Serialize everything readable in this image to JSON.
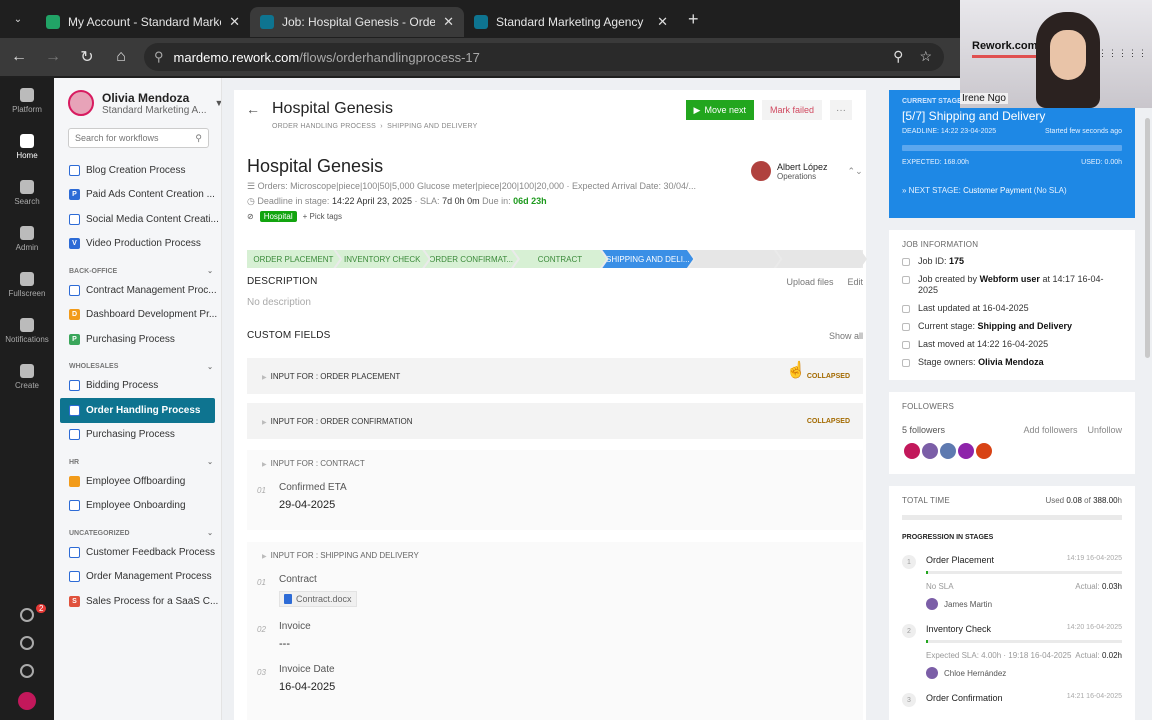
{
  "browser": {
    "tabs": [
      {
        "label": "My Account - Standard Marketi",
        "color": "#21a366",
        "active": false
      },
      {
        "label": "Job: Hospital Genesis - Order H",
        "color": "#0e7490",
        "active": true
      },
      {
        "label": "Standard Marketing Agency",
        "color": "#0e7490",
        "active": false
      }
    ],
    "url_host": "mardemo.rework.com",
    "url_path": "/flows/orderhandlingprocess-17"
  },
  "rail": {
    "items": [
      "Platform",
      "Home",
      "Search",
      "Admin",
      "Fullscreen",
      "Notifications",
      "Create"
    ],
    "badge": "2"
  },
  "sidebar": {
    "user_name": "Olivia Mendoza",
    "user_org": "Standard Marketing A...",
    "search_placeholder": "Search for workflows",
    "top_items": [
      {
        "label": "Blog Creation Process",
        "icon": "outline"
      },
      {
        "label": "Paid Ads Content Creation ...",
        "icon": "blue",
        "letter": "P"
      },
      {
        "label": "Social Media Content Creati...",
        "icon": "outline"
      },
      {
        "label": "Video Production Process",
        "icon": "blue",
        "letter": "V"
      }
    ],
    "groups": [
      {
        "name": "BACK-OFFICE",
        "items": [
          {
            "label": "Contract Management Proc...",
            "icon": "outline"
          },
          {
            "label": "Dashboard Development Pr...",
            "icon": "orange",
            "letter": "D"
          },
          {
            "label": "Purchasing Process",
            "icon": "green",
            "letter": "P"
          }
        ]
      },
      {
        "name": "WHOLESALES",
        "items": [
          {
            "label": "Bidding Process",
            "icon": "outline"
          },
          {
            "label": "Order Handling Process",
            "icon": "outline",
            "active": true
          },
          {
            "label": "Purchasing Process",
            "icon": "outline"
          }
        ]
      },
      {
        "name": "HR",
        "items": [
          {
            "label": "Employee Offboarding",
            "icon": "orange"
          },
          {
            "label": "Employee Onboarding",
            "icon": "outline"
          }
        ]
      },
      {
        "name": "UNCATEGORIZED",
        "items": [
          {
            "label": "Customer Feedback Process",
            "icon": "outline"
          },
          {
            "label": "Order Management Process",
            "icon": "outline"
          },
          {
            "label": "Sales Process for a SaaS C...",
            "icon": "red",
            "letter": "S"
          }
        ]
      }
    ]
  },
  "header": {
    "title": "Hospital Genesis",
    "crumb_1": "ORDER HANDLING PROCESS",
    "crumb_2": "SHIPPING AND DELIVERY",
    "move_next": "Move next",
    "mark_failed": "Mark failed",
    "more": "···"
  },
  "job": {
    "title": "Hospital Genesis",
    "meta": "Orders: Microscope|piece|100|50|5,000 Glucose meter|piece|200|100|20,000 · Expected Arrival Date: 30/04/...",
    "deadline_label": "Deadline in stage:",
    "deadline_value": "14:22 April 23, 2025",
    "sla_label": "· SLA:",
    "sla_value": "7d 0h 0m",
    "due_label": "Due in:",
    "due_value": "06d 23h",
    "tag": "Hospital",
    "pick_tags": "+ Pick tags",
    "assignee_name": "Albert López",
    "assignee_role": "Operations"
  },
  "stages": [
    {
      "label": "ORDER PLACEMENT",
      "state": "done"
    },
    {
      "label": "INVENTORY CHECK",
      "state": "done"
    },
    {
      "label": "ORDER CONFIRMAT...",
      "state": "done"
    },
    {
      "label": "CONTRACT",
      "state": "done"
    },
    {
      "label": "SHIPPING AND DELI...",
      "state": "current"
    },
    {
      "label": "",
      "state": "pending"
    },
    {
      "label": "",
      "state": "pending"
    }
  ],
  "description": {
    "title": "DESCRIPTION",
    "upload": "Upload files",
    "edit": "Edit",
    "empty": "No description"
  },
  "custom_fields": {
    "title": "CUSTOM FIELDS",
    "show_all": "Show all",
    "collapsed_label": "COLLAPSED",
    "sections": [
      {
        "label": "INPUT FOR : ORDER PLACEMENT"
      },
      {
        "label": "INPUT FOR : ORDER CONFIRMATION"
      },
      {
        "label": "INPUT FOR : CONTRACT",
        "fields": [
          {
            "num": "01",
            "label": "Confirmed ETA",
            "value": "29-04-2025"
          }
        ]
      },
      {
        "label": "INPUT FOR : SHIPPING AND DELIVERY",
        "fields": [
          {
            "num": "01",
            "label": "Contract",
            "file": "Contract.docx"
          },
          {
            "num": "02",
            "label": "Invoice",
            "value": "---"
          },
          {
            "num": "03",
            "label": "Invoice Date",
            "value": "16-04-2025"
          }
        ]
      }
    ]
  },
  "current_stage": {
    "label": "CURRENT STAGE",
    "title": "[5/7] Shipping and Delivery",
    "deadline": "DEADLINE: 14:22 23-04-2025",
    "started": "Started few seconds ago",
    "expected": "EXPECTED: 168.00h",
    "used": "USED: 0.00h",
    "next_label": "» NEXT STAGE:",
    "next_value": "Customer Payment",
    "next_sla": "(No SLA)"
  },
  "job_info": {
    "title": "JOB INFORMATION",
    "job_id_label": "Job ID:",
    "job_id": "175",
    "created_pre": "Job created by",
    "created_by": "Webform user",
    "created_post": "at 14:17 16-04-2025",
    "updated": "Last updated at 16-04-2025",
    "stage_label": "Current stage:",
    "stage_value": "Shipping and Delivery",
    "moved": "Last moved at 14:22 16-04-2025",
    "owners_label": "Stage owners:",
    "owners_value": "Olivia Mendoza"
  },
  "followers": {
    "title": "FOLLOWERS",
    "count": "5 followers",
    "add": "Add followers",
    "unfollow": "Unfollow",
    "avatar_colors": [
      "#c2185b",
      "#7b5ea7",
      "#5e7ab0",
      "#8e24aa",
      "#d84315"
    ]
  },
  "total_time": {
    "title": "TOTAL TIME",
    "used_label": "Used",
    "used": "0.08",
    "of": "of",
    "total": "388.00",
    "unit": "h",
    "progress_title": "PROGRESSION IN STAGES",
    "stages": [
      {
        "num": "1",
        "name": "Order Placement",
        "time": "14:19 16-04-2025",
        "sla": "No SLA",
        "actual_label": "Actual:",
        "actual": "0.03h",
        "person": "James Martin",
        "fill": 0
      },
      {
        "num": "2",
        "name": "Inventory Check",
        "time": "14:20 16-04-2025",
        "sla": "Expected SLA: 4.00h · 19:18 16-04-2025",
        "actual_label": "Actual:",
        "actual": "0.02h",
        "person": "Chloe Hernández",
        "fill": 0.01
      },
      {
        "num": "3",
        "name": "Order Confirmation",
        "time": "14:21 16-04-2025"
      }
    ]
  },
  "webcam": {
    "logo": "Rework.com",
    "name": "Irene Ngo"
  }
}
